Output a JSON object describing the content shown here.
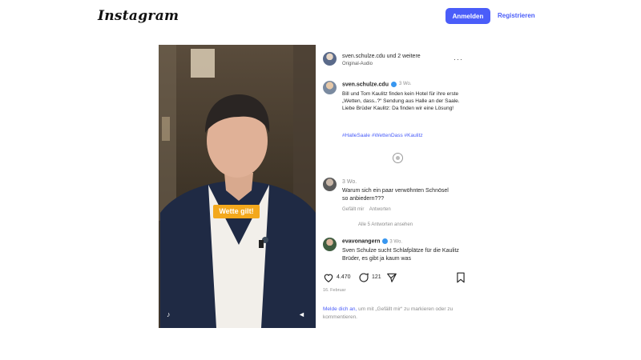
{
  "app": {
    "logo": "Instagram"
  },
  "topbar": {
    "login_label": "Anmelden",
    "register_label": "Registrieren"
  },
  "media": {
    "overlay_text": "Wette gilt!"
  },
  "post_header": {
    "username": "sven.schulze.cdu und 2 weitere",
    "audio": "Original-Audio"
  },
  "caption": {
    "username": "sven.schulze.cdu",
    "time": "3 Wo.",
    "text": "Bill und Tom Kaulitz finden kein Hotel für ihre erste „Wetten, dass..?“ Sendung aus Halle an der Saale. Liebe Brüder Kaulitz: Da finden wir eine Lösung!",
    "hashtags": "#HalleSaale #WettenDass #Kaulitz"
  },
  "comments": [
    {
      "username": "",
      "time": "3 Wo.",
      "text": "Warum sich ein paar verwöhnten Schnösel so anbiedern???",
      "likes": "Gefällt mir",
      "reply_label": "Antworten",
      "view_replies": "Alle 5 Antworten ansehen"
    },
    {
      "username": "evavonangern",
      "time": "3 Wo.",
      "text": "Sven Schulze sucht Schlafplätze für die Kaulitz Brüder, es gibt ja kaum was"
    }
  ],
  "actions": {
    "likes": "4.470",
    "comments": "121"
  },
  "post_date": "16. Februar",
  "login_note": {
    "link": "Melde dich an,",
    "rest": " um mit „Gefällt mir“ zu markieren oder zu kommentieren."
  },
  "colors": {
    "accent": "#4a5df9",
    "badge": "#f3a81c",
    "verified": "#3897f0"
  }
}
